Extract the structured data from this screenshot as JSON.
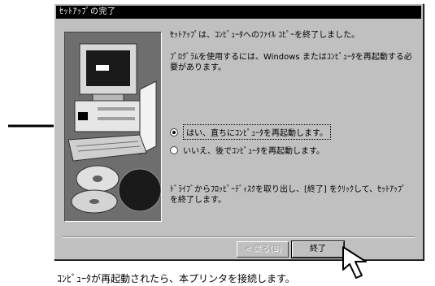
{
  "dialog": {
    "title": "ｾｯﾄｱｯﾌﾟの完了",
    "message1": "ｾｯﾄｱｯﾌﾟは、ｺﾝﾋﾟｭｰﾀへのﾌｧｲﾙ ｺﾋﾟｰを終了しました。",
    "message2": "ﾌﾟﾛｸﾞﾗﾑを使用するには、Windows またはｺﾝﾋﾟｭｰﾀを再起動する必要があります。",
    "options": [
      {
        "label": "はい、直ちにｺﾝﾋﾟｭｰﾀを再起動します。",
        "selected": true
      },
      {
        "label": "いいえ、後でｺﾝﾋﾟｭｰﾀを再起動します。",
        "selected": false
      }
    ],
    "message3": "ﾄﾞﾗｲﾌﾞからﾌﾛｯﾋﾟｰﾃﾞｨｽｸを取り出し、[終了] をｸﾘｯｸして、ｾｯﾄｱｯﾌﾟを終了します。",
    "buttons": {
      "back": "< 戻る(B)",
      "finish": "終了"
    }
  },
  "caption": "ｺﾝﾋﾟｭｰﾀが再起動されたら、本プリンタを接続します。",
  "colors": {
    "dialog_face": "#c0c0c0",
    "title_bar": "#000000",
    "arrow": "#000000"
  },
  "icons": [
    "computer-illustration",
    "cd-rom-illustration",
    "arrow-pointer",
    "mouse-cursor-icon"
  ]
}
